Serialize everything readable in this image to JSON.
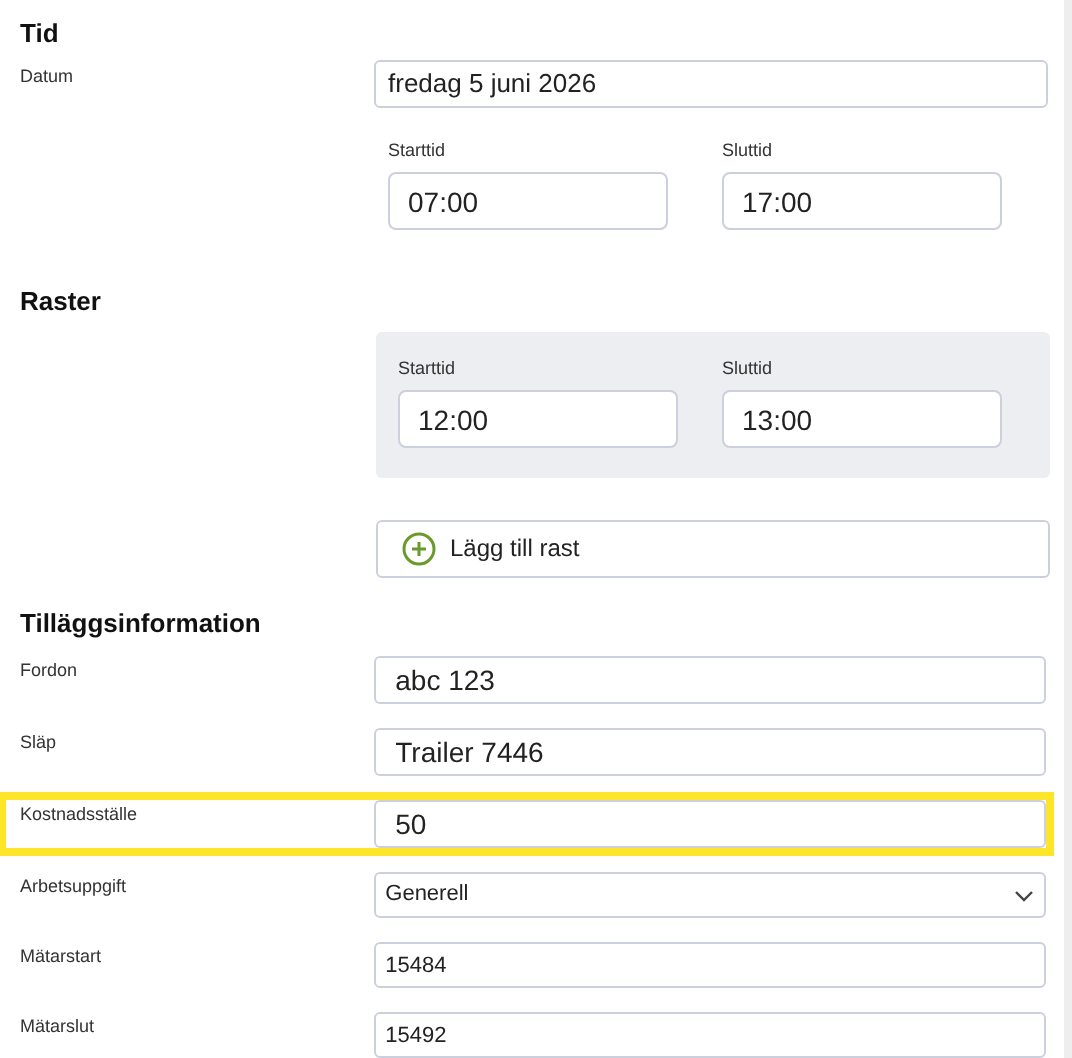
{
  "time": {
    "heading": "Tid",
    "date_label": "Datum",
    "date_value": "fredag 5 juni 2026",
    "start_label": "Starttid",
    "start_value": "07:00",
    "end_label": "Sluttid",
    "end_value": "17:00"
  },
  "breaks": {
    "heading": "Raster",
    "items": [
      {
        "start_label": "Starttid",
        "start_value": "12:00",
        "end_label": "Sluttid",
        "end_value": "13:00"
      }
    ],
    "add_button": "Lägg till rast"
  },
  "extra": {
    "heading": "Tilläggsinformation",
    "fields": [
      {
        "kind": "text",
        "label": "Fordon",
        "value": "abc 123",
        "highlighted": false
      },
      {
        "kind": "text",
        "label": "Släp",
        "value": "Trailer 7446",
        "highlighted": false
      },
      {
        "kind": "text",
        "label": "Kostnadsställe",
        "value": "50",
        "highlighted": true
      },
      {
        "kind": "select",
        "label": "Arbetsuppgift",
        "value": "Generell",
        "highlighted": false
      },
      {
        "kind": "number",
        "label": "Mätarstart",
        "value": "15484",
        "highlighted": false
      },
      {
        "kind": "number",
        "label": "Mätarslut",
        "value": "15492",
        "highlighted": false
      }
    ]
  }
}
